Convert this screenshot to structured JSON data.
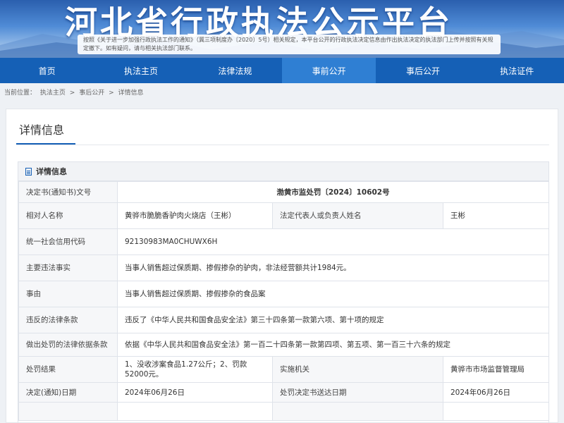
{
  "banner": {
    "title": "河北省行政执法公示平台",
    "notice": "按照《关于进一步加强行政执法工作的通知》（冀三项制度办〔2020〕5号）相关规定，本平台公开的行政执法决定信息由作出执法决定的执法部门上传并按照有关规定撤下。如有疑问，请与相关执法部门联系。"
  },
  "nav": {
    "items": [
      "首页",
      "执法主页",
      "法律法规",
      "事前公开",
      "事后公开",
      "执法证件"
    ],
    "active_index": 3
  },
  "breadcrumb": {
    "prefix": "当前位置：",
    "items": [
      "执法主页",
      "事后公开",
      "详情信息"
    ],
    "separator": ">"
  },
  "card": {
    "title": "详情信息",
    "panel_title": "详情信息"
  },
  "details": {
    "doc_no_label": "决定书(通知书)文号",
    "doc_no": "渤黄市监处罚〔2024〕10602号",
    "party_label": "相对人名称",
    "party": "黄骅市脆脆香驴肉火烧店（王彬）",
    "rep_label": "法定代表人或负责人姓名",
    "rep": "王彬",
    "credit_label": "统一社会信用代码",
    "credit": "92130983MA0CHUWX6H",
    "facts_label": "主要违法事实",
    "facts": "当事人销售超过保质期、掺假掺杂的驴肉，非法经营额共计1984元。",
    "cause_label": "事由",
    "cause": "当事人销售超过保质期、掺假掺杂的食品案",
    "violated_label": "违反的法律条款",
    "violated": "违反了《中华人民共和国食品安全法》第三十四条第一款第六项、第十项的规定",
    "basis_label": "做出处罚的法律依据条款",
    "basis": "依据《中华人民共和国食品安全法》第一百二十四条第一款第四项、第五项、第一百三十六条的规定",
    "result_label": "处罚结果",
    "result": "1、没收涉案食品1.27公斤；2、罚款52000元。",
    "agency_label": "实施机关",
    "agency": "黄骅市市场监督管理局",
    "date_label": "决定(通知)日期",
    "date": "2024年06月26日",
    "delivery_label": "处罚决定书送达日期",
    "delivery": "2024年06月26日"
  },
  "colors": {
    "nav_bg": "#1560b6",
    "nav_active": "#2f7fd3",
    "label_bg": "#f6f7f9"
  }
}
